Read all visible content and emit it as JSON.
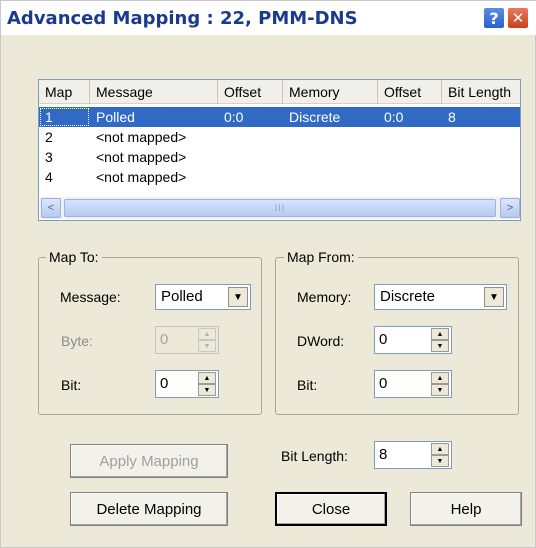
{
  "window": {
    "title": "Advanced Mapping : 22, PMM-DNS",
    "help_button": "?",
    "close_button": "✕"
  },
  "list": {
    "columns": [
      "Map",
      "Message",
      "Offset",
      "Memory",
      "Offset",
      "Bit Length"
    ],
    "rows": [
      {
        "map": "1",
        "message": "Polled",
        "offset": "0:0",
        "memory": "Discrete",
        "offset2": "0:0",
        "bit_length": "8",
        "selected": true
      },
      {
        "map": "2",
        "message": "<not mapped>",
        "offset": "",
        "memory": "",
        "offset2": "",
        "bit_length": "",
        "selected": false
      },
      {
        "map": "3",
        "message": "<not mapped>",
        "offset": "",
        "memory": "",
        "offset2": "",
        "bit_length": "",
        "selected": false
      },
      {
        "map": "4",
        "message": "<not mapped>",
        "offset": "",
        "memory": "",
        "offset2": "",
        "bit_length": "",
        "selected": false
      }
    ],
    "scroll_left": "<",
    "scroll_right": ">",
    "scroll_thumb_grip": "III"
  },
  "map_to": {
    "title": "Map To:",
    "message_label": "Message:",
    "message_value": "Polled",
    "byte_label": "Byte:",
    "byte_value": "0",
    "bit_label": "Bit:",
    "bit_value": "0"
  },
  "map_from": {
    "title": "Map From:",
    "memory_label": "Memory:",
    "memory_value": "Discrete",
    "dword_label": "DWord:",
    "dword_value": "0",
    "bit_label": "Bit:",
    "bit_value": "0"
  },
  "bit_length": {
    "label": "Bit Length:",
    "value": "8"
  },
  "buttons": {
    "apply": "Apply Mapping",
    "delete": "Delete Mapping",
    "close": "Close",
    "help": "Help"
  },
  "icons": {
    "dropdown": "▼",
    "spin_up": "▲",
    "spin_down": "▼"
  }
}
